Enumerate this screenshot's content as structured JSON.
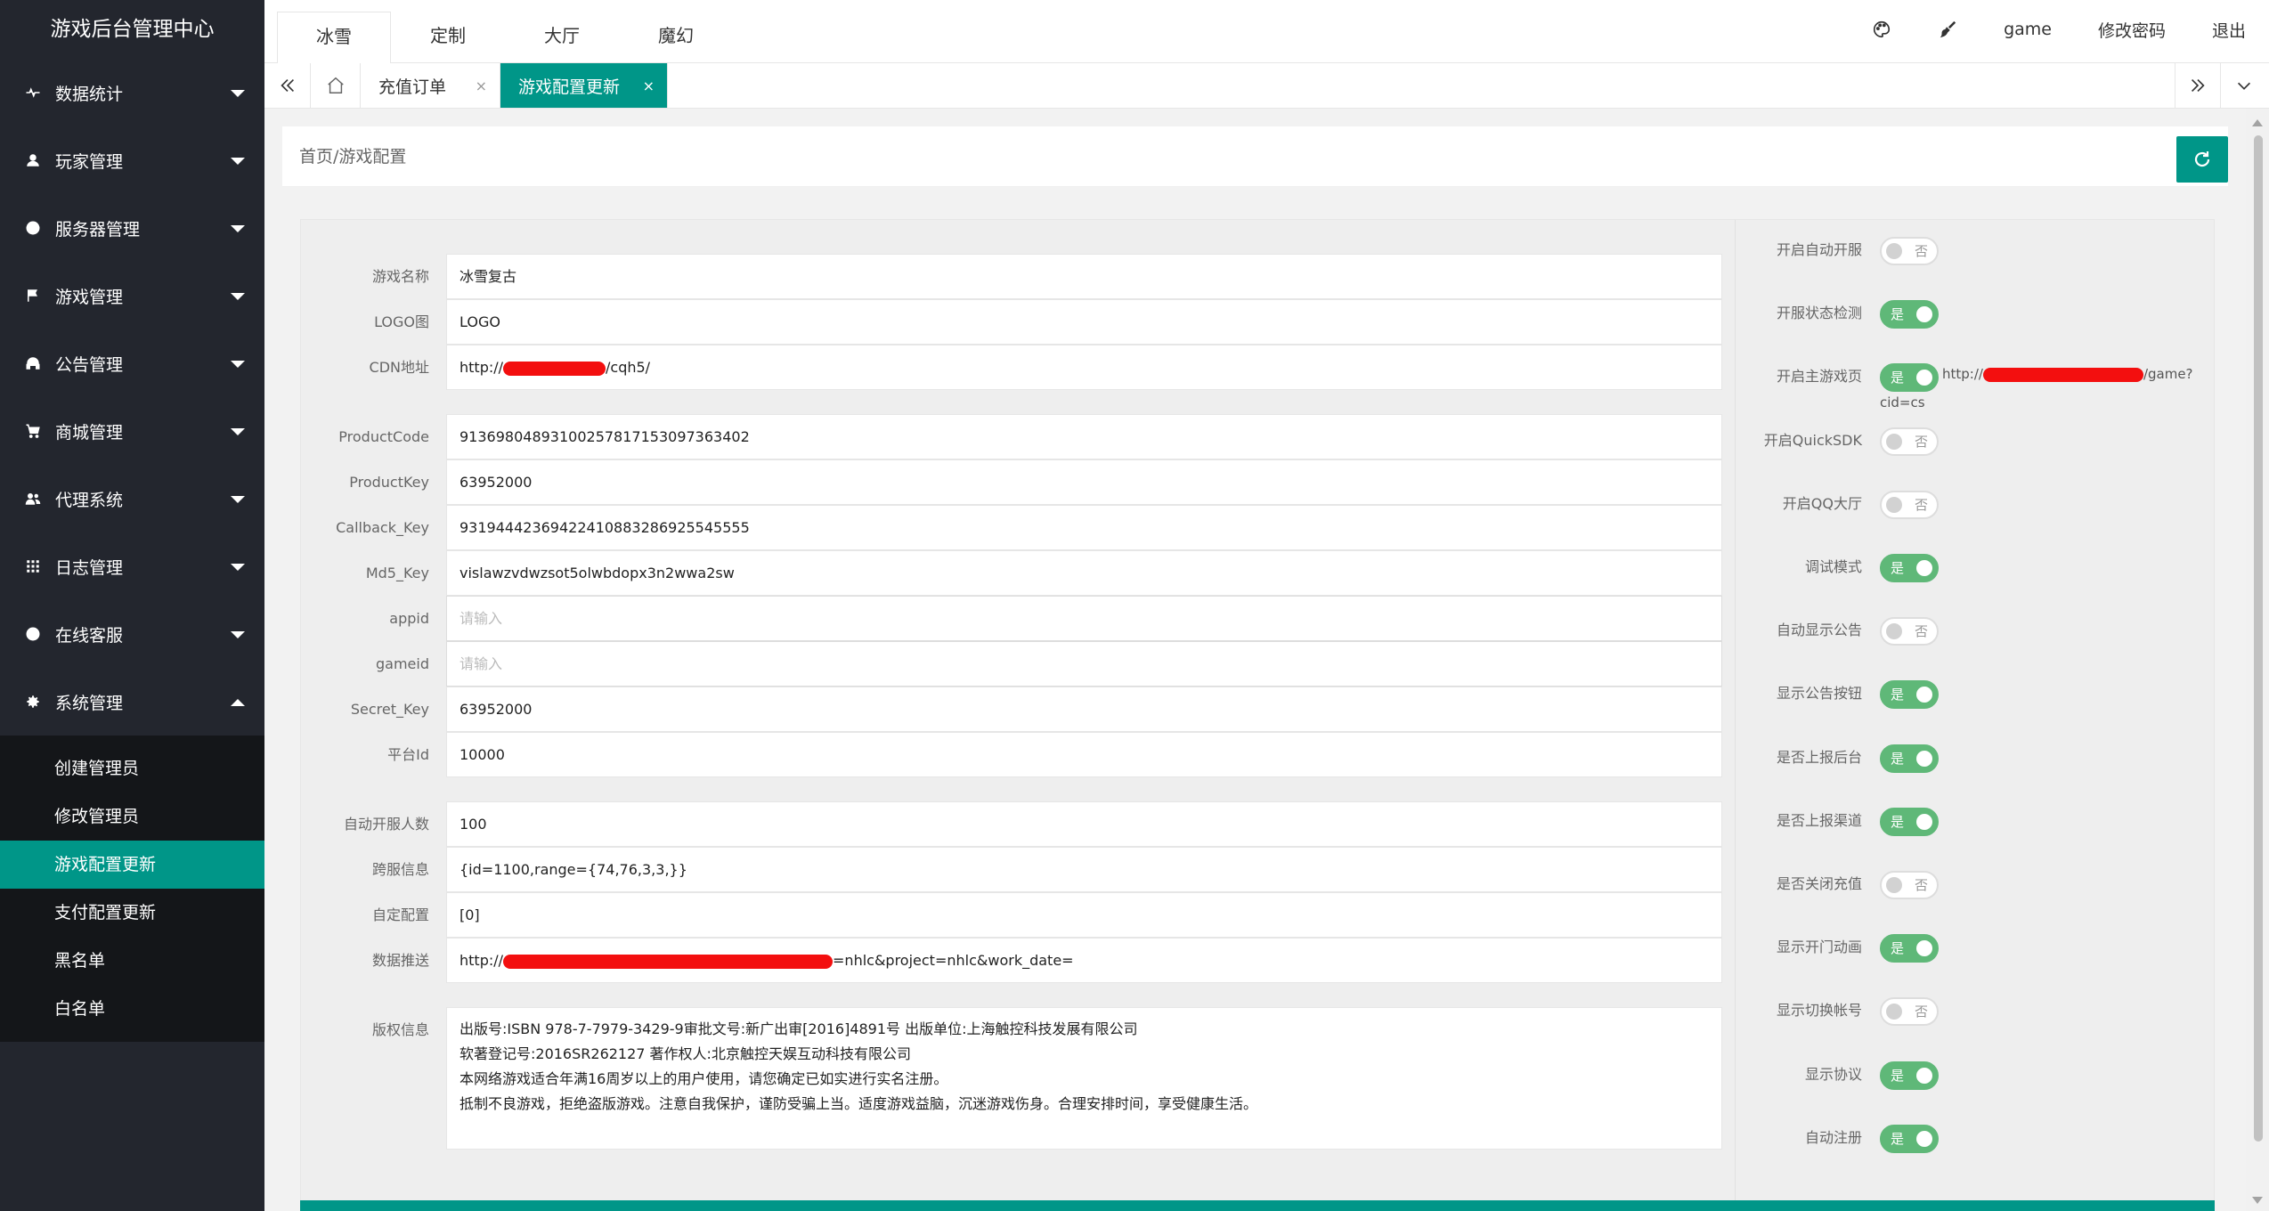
{
  "app_title": "游戏后台管理中心",
  "sidebar": {
    "items": [
      {
        "label": "数据统计",
        "icon": "pulse-icon"
      },
      {
        "label": "玩家管理",
        "icon": "user-icon"
      },
      {
        "label": "服务器管理",
        "icon": "globe-icon"
      },
      {
        "label": "游戏管理",
        "icon": "flag-icon"
      },
      {
        "label": "公告管理",
        "icon": "headset-icon"
      },
      {
        "label": "商城管理",
        "icon": "cart-icon"
      },
      {
        "label": "代理系统",
        "icon": "users-icon"
      },
      {
        "label": "日志管理",
        "icon": "grid-icon"
      },
      {
        "label": "在线客服",
        "icon": "smile-icon"
      },
      {
        "label": "系统管理",
        "icon": "gear-icon"
      }
    ],
    "sub_items": [
      "创建管理员",
      "修改管理员",
      "游戏配置更新",
      "支付配置更新",
      "黑名单",
      "白名单"
    ],
    "active_sub": "游戏配置更新"
  },
  "top_tabs": [
    "冰雪",
    "定制",
    "大厅",
    "魔幻"
  ],
  "top_right": {
    "user": "game",
    "change_password": "修改密码",
    "logout": "退出"
  },
  "page_tabs": [
    {
      "label": "充值订单",
      "close": "×"
    },
    {
      "label": "游戏配置更新",
      "close": "×"
    }
  ],
  "breadcrumb": "首页/游戏配置",
  "form": {
    "game_name": {
      "label": "游戏名称",
      "value": "冰雪复古"
    },
    "logo": {
      "label": "LOGO图",
      "value": "LOGO"
    },
    "cdn": {
      "label": "CDN地址",
      "prefix": "http://",
      "suffix": "/cqh5/"
    },
    "product_code": {
      "label": "ProductCode",
      "value": "91369804893100257817153097363402"
    },
    "product_key": {
      "label": "ProductKey",
      "value": "63952000"
    },
    "callback_key": {
      "label": "Callback_Key",
      "value": "93194442369422410883286925545555"
    },
    "md5_key": {
      "label": "Md5_Key",
      "value": "vislawzvdwzsot5olwbdopx3n2wwa2sw"
    },
    "appid": {
      "label": "appid",
      "placeholder": "请输入"
    },
    "gameid": {
      "label": "gameid",
      "placeholder": "请输入"
    },
    "secret_key": {
      "label": "Secret_Key",
      "value": "63952000"
    },
    "platform_id": {
      "label": "平台Id",
      "value": "10000"
    },
    "auto_open_count": {
      "label": "自动开服人数",
      "value": "100"
    },
    "cross_server": {
      "label": "跨服信息",
      "value": "{id=1100,range={74,76,3,3,}}"
    },
    "custom_config": {
      "label": "自定配置",
      "value": "[0]"
    },
    "data_push": {
      "label": "数据推送",
      "prefix": "http://",
      "suffix": "=nhlc&project=nhlc&work_date="
    },
    "copyright": {
      "label": "版权信息",
      "lines": [
        "出版号:ISBN 978-7-7979-3429-9审批文号:新广出审[2016]4891号 出版单位:上海触控科技发展有限公司",
        "软著登记号:2016SR262127 著作权人:北京触控天娱互动科技有限公司",
        "本网络游戏适合年满16周岁以上的用户使用，请您确定已如实进行实名注册。",
        "抵制不良游戏，拒绝盗版游戏。注意自我保护，谨防受骗上当。适度游戏益脑，沉迷游戏伤身。合理安排时间，享受健康生活。"
      ]
    }
  },
  "toggles": [
    {
      "label": "开启自动开服",
      "state": "否",
      "on": false
    },
    {
      "label": "开服状态检测",
      "state": "是",
      "on": true
    },
    {
      "label": "开启主游戏页",
      "state": "是",
      "on": true,
      "extra_prefix": "http://",
      "extra_suffix": "/game?",
      "extra_line2": "cid=cs"
    },
    {
      "label": "开启QuickSDK",
      "state": "否",
      "on": false
    },
    {
      "label": "开启QQ大厅",
      "state": "否",
      "on": false
    },
    {
      "label": "调试模式",
      "state": "是",
      "on": true
    },
    {
      "label": "自动显示公告",
      "state": "否",
      "on": false
    },
    {
      "label": "显示公告按钮",
      "state": "是",
      "on": true
    },
    {
      "label": "是否上报后台",
      "state": "是",
      "on": true
    },
    {
      "label": "是否上报渠道",
      "state": "是",
      "on": true
    },
    {
      "label": "是否关闭充值",
      "state": "否",
      "on": false
    },
    {
      "label": "显示开门动画",
      "state": "是",
      "on": true
    },
    {
      "label": "显示切换帐号",
      "state": "否",
      "on": false
    },
    {
      "label": "显示协议",
      "state": "是",
      "on": true
    },
    {
      "label": "自动注册",
      "state": "是",
      "on": true
    }
  ],
  "colors": {
    "accent": "#009688",
    "sidebar_bg": "#23262e",
    "switch_on": "#5fb878"
  }
}
